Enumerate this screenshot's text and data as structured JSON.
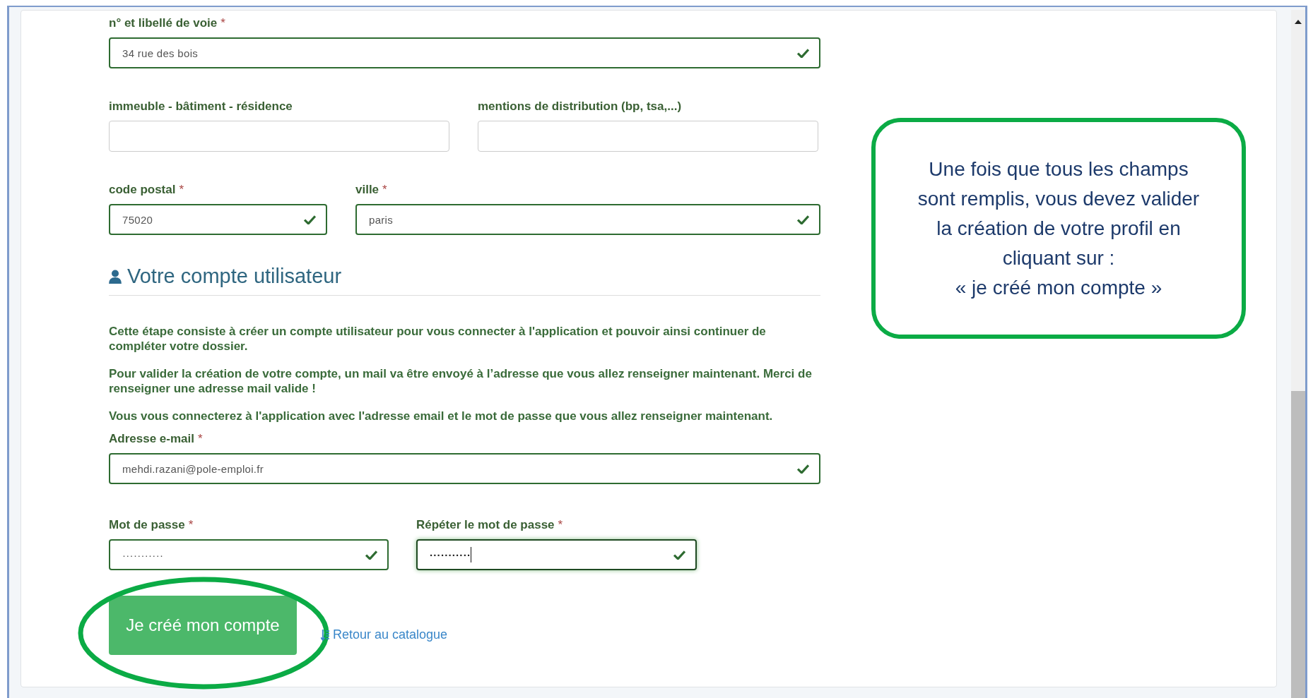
{
  "address_rows": [
    {
      "kind": "full",
      "fields": [
        {
          "label": "n° et libellé de voie",
          "required_mark": "*",
          "value": "34 rue des bois",
          "valid": true
        }
      ]
    },
    {
      "kind": "half",
      "fields": [
        {
          "label": "immeuble - bâtiment - résidence",
          "valid": false
        },
        {
          "label": "mentions de distribution (bp, tsa,...)",
          "valid": false
        }
      ]
    },
    {
      "kind": "postal",
      "fields": [
        {
          "label": "code postal",
          "required_mark": "*",
          "value": "75020",
          "valid": true
        },
        {
          "label": "ville",
          "required_mark": "*",
          "value": "paris",
          "valid": true
        }
      ]
    }
  ],
  "section": {
    "title": "Votre compte utilisateur"
  },
  "paragraphs": [
    "Cette étape consiste à créer un compte utilisateur pour vous connecter à l'application et pouvoir ainsi continuer de compléter votre dossier.",
    "Pour valider la création de votre compte, un mail va être envoyé à l’adresse que vous allez renseigner maintenant. Merci de renseigner une adresse mail valide !",
    "Vous vous connecterez à l'application avec l'adresse email et le mot de passe que vous allez renseigner maintenant."
  ],
  "account_rows": [
    {
      "kind": "full",
      "fields": [
        {
          "label": "Adresse e-mail",
          "required_mark": "*",
          "value": "mehdi.razani@pole-emploi.fr",
          "valid": true
        }
      ]
    },
    {
      "kind": "password",
      "fields": [
        {
          "label": "Mot de passe",
          "required_mark": "*",
          "value": "···········",
          "valid": true,
          "focused": false
        },
        {
          "label": "Répéter le mot de passe",
          "required_mark": "*",
          "value": "···········",
          "valid": true,
          "focused": true
        }
      ]
    }
  ],
  "submit_button": {
    "label": "Je créé mon compte"
  },
  "back_link": {
    "label": "Retour au catalogue"
  },
  "callout": {
    "lines": [
      "Une fois que tous les champs",
      "sont remplis, vous devez valider",
      "la création de votre profil en",
      "cliquant sur :",
      "« je créé mon compte »"
    ]
  }
}
